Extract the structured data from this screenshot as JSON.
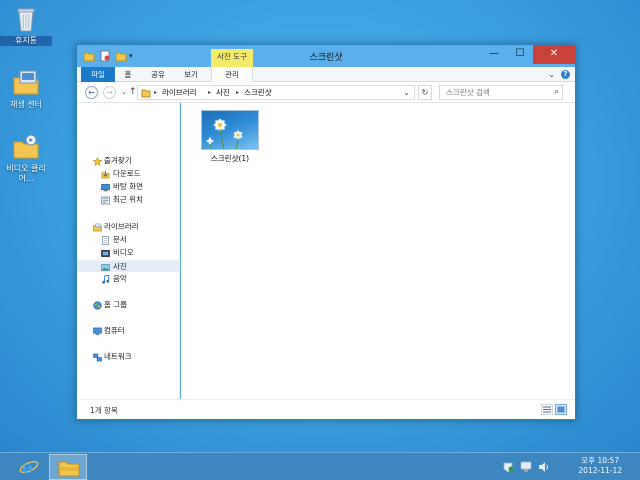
{
  "desktop": {
    "icons": [
      {
        "label": "휴지통"
      },
      {
        "label": "재생 센터"
      },
      {
        "label": "비디오 클리어..."
      }
    ]
  },
  "window": {
    "title": "스크린샷",
    "tool_tab": "사진 도구",
    "controls": {
      "minimize": "—",
      "maximize": "☐",
      "close": "✕"
    },
    "ribbon_tabs": [
      "파일",
      "홈",
      "공유",
      "보기",
      "관리"
    ],
    "ribbon_caret": "⌄",
    "help": "?",
    "nav": {
      "back": "←",
      "forward": "→",
      "recent": "⌄",
      "up": "↑"
    },
    "address": {
      "crumbs": [
        "라이브러리",
        "사진",
        "스크린샷"
      ],
      "separator": "▸",
      "dropdown": "⌄"
    },
    "refresh": "↻",
    "search": {
      "placeholder": "스크린샷 검색",
      "icon": "⌕"
    },
    "nav_pane": {
      "favorites": {
        "label": "즐겨찾기",
        "items": [
          "다운로드",
          "바탕 화면",
          "최근 위치"
        ]
      },
      "libraries": {
        "label": "라이브러리",
        "items": [
          "문서",
          "비디오",
          "사진",
          "음악"
        ],
        "selected": "사진"
      },
      "homegroup": "홈 그룹",
      "computer": "컴퓨터",
      "network": "네트워크"
    },
    "files": [
      {
        "name": "스크린샷(1)"
      }
    ],
    "status": "1개 항목"
  },
  "taskbar": {
    "clock_time": "오후 10:57",
    "clock_date": "2012-11-12"
  },
  "colors": {
    "desktop": "#3aa0e0",
    "window_frame": "#5ab0ec",
    "close_button": "#c7433a",
    "file_tab": "#1979ca",
    "tool_tab": "#f3ea6a",
    "taskbar": "#3d86c0"
  }
}
